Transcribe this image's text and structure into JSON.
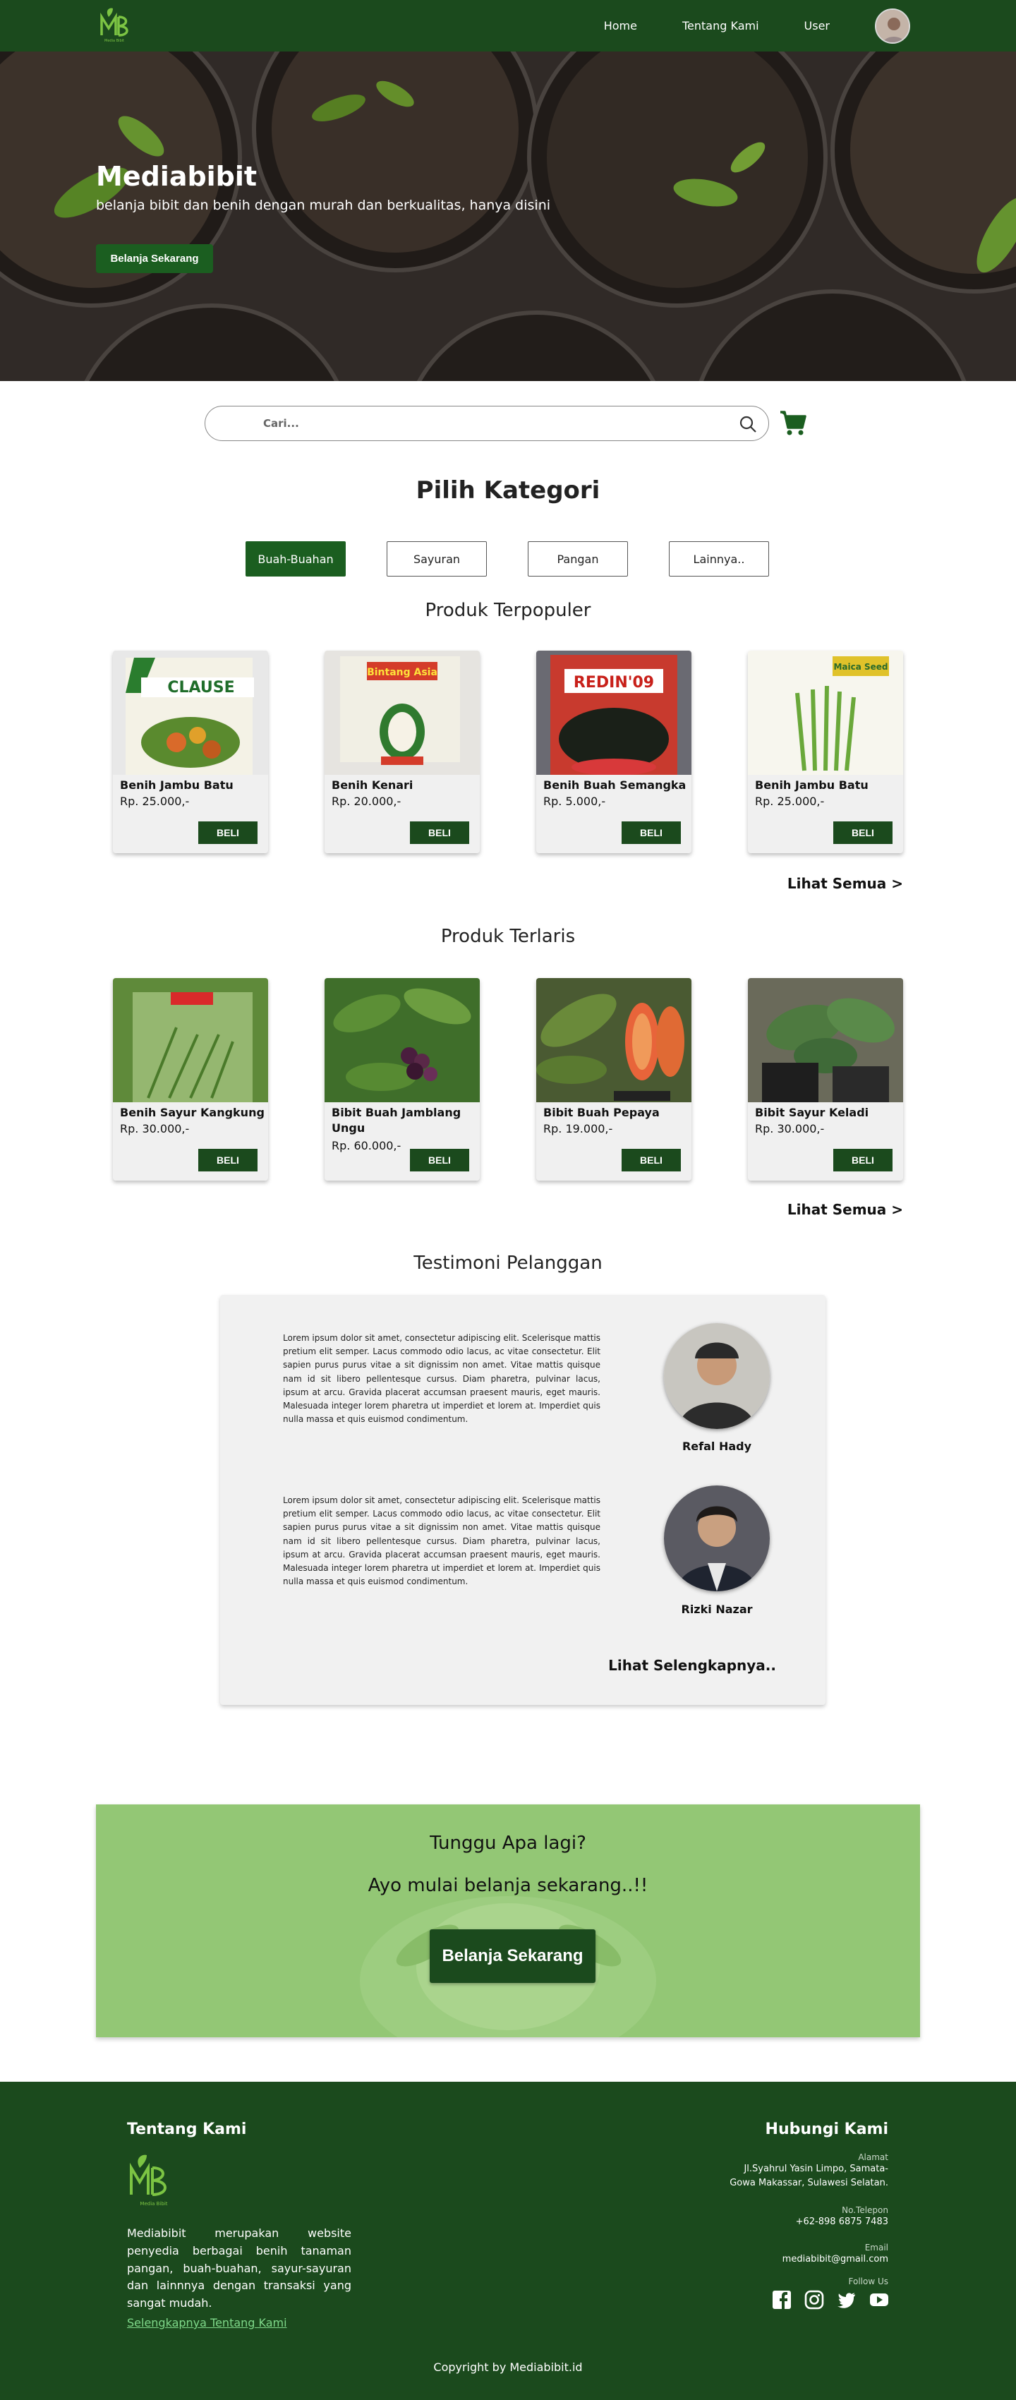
{
  "nav": {
    "links": [
      "Home",
      "Tentang Kami",
      "User"
    ]
  },
  "hero": {
    "title": "Mediabibit",
    "subtitle": "belanja bibit dan benih dengan murah dan berkualitas, hanya disini",
    "cta": "Belanja Sekarang"
  },
  "search": {
    "placeholder": "Cari..."
  },
  "category": {
    "title": "Pilih Kategori",
    "items": [
      "Buah-Buahan",
      "Sayuran",
      "Pangan",
      "Lainnya.."
    ],
    "active": "Buah-Buahan"
  },
  "popular": {
    "title": "Produk Terpopuler",
    "see_all": "Lihat Semua >",
    "products": [
      {
        "name": "Benih Jambu Batu",
        "price": "Rp. 25.000,-",
        "button": "BELI"
      },
      {
        "name": "Benih Kenari",
        "price": "Rp. 20.000,-",
        "button": "BELI"
      },
      {
        "name": "Benih Buah Semangka",
        "price": "Rp. 5.000,-",
        "button": "BELI"
      },
      {
        "name": "Benih Jambu Batu",
        "price": "Rp. 25.000,-",
        "button": "BELI"
      }
    ]
  },
  "bestseller": {
    "title": "Produk Terlaris",
    "see_all": "Lihat Semua >",
    "products": [
      {
        "name": "Benih Sayur Kangkung",
        "price": "Rp. 30.000,-",
        "button": "BELI"
      },
      {
        "name": "Bibit  Buah Jamblang Ungu",
        "price": "Rp. 60.000,-",
        "button": "BELI"
      },
      {
        "name": "Bibit Buah Pepaya",
        "price": "Rp. 19.000,-",
        "button": "BELI"
      },
      {
        "name": "Bibit Sayur Keladi",
        "price": "Rp. 30.000,-",
        "button": "BELI"
      }
    ]
  },
  "testimonials": {
    "title": "Testimoni Pelanggan",
    "items": [
      {
        "text": "Lorem ipsum dolor sit amet, consectetur adipiscing elit. Scelerisque mattis pretium elit semper. Lacus commodo odio lacus, ac vitae consectetur. Elit sapien purus purus vitae a sit dignissim non amet. Vitae mattis quisque nam id sit libero pellentesque cursus. Diam pharetra, pulvinar lacus, ipsum at arcu. Gravida placerat accumsan praesent mauris, eget mauris. Malesuada integer lorem pharetra ut imperdiet et lorem at. Imperdiet quis nulla massa et quis euismod condimentum.",
        "name": "Refal Hady"
      },
      {
        "text": "Lorem ipsum dolor sit amet, consectetur adipiscing elit. Scelerisque mattis pretium elit semper. Lacus commodo odio lacus, ac vitae consectetur. Elit sapien purus purus vitae a sit dignissim non amet. Vitae mattis quisque nam id sit libero pellentesque cursus. Diam pharetra, pulvinar lacus, ipsum at arcu. Gravida placerat accumsan praesent mauris, eget mauris. Malesuada integer lorem pharetra ut imperdiet et lorem at. Imperdiet quis nulla massa et quis euismod condimentum.",
        "name": "Rizki Nazar"
      }
    ],
    "more": "Lihat Selengkapnya.."
  },
  "cta": {
    "question": "Tunggu Apa lagi?",
    "sub": "Ayo mulai belanja sekarang..!!",
    "button": "Belanja Sekarang"
  },
  "footer": {
    "about_title": "Tentang Kami",
    "about_text": "Mediabibit merupakan website penyedia berbagai benih tanaman pangan, buah-buahan, sayur-sayuran dan lainnnya dengan transaksi yang sangat mudah.",
    "about_link": "Selengkapnya Tentang Kami",
    "contact_title": "Hubungi Kami",
    "address_label": "Alamat",
    "address": "Jl.Syahrul Yasin Limpo, Samata-Gowa Makassar, Sulawesi Selatan.",
    "phone_label": "No.Telepon",
    "phone": "+62-898 6875 7483",
    "email_label": "Email",
    "email": "mediabibit@gmail.com",
    "follow_label": "Follow Us",
    "copyright": "Copyright by Mediabibit.id"
  },
  "colors": {
    "brand_green": "#1b4a1d",
    "button_green": "#1b5e20",
    "card_bg": "#f0f0f0"
  },
  "icons": [
    "logo-icon",
    "search-icon",
    "cart-icon",
    "facebook-icon",
    "instagram-icon",
    "twitter-icon",
    "youtube-icon"
  ]
}
